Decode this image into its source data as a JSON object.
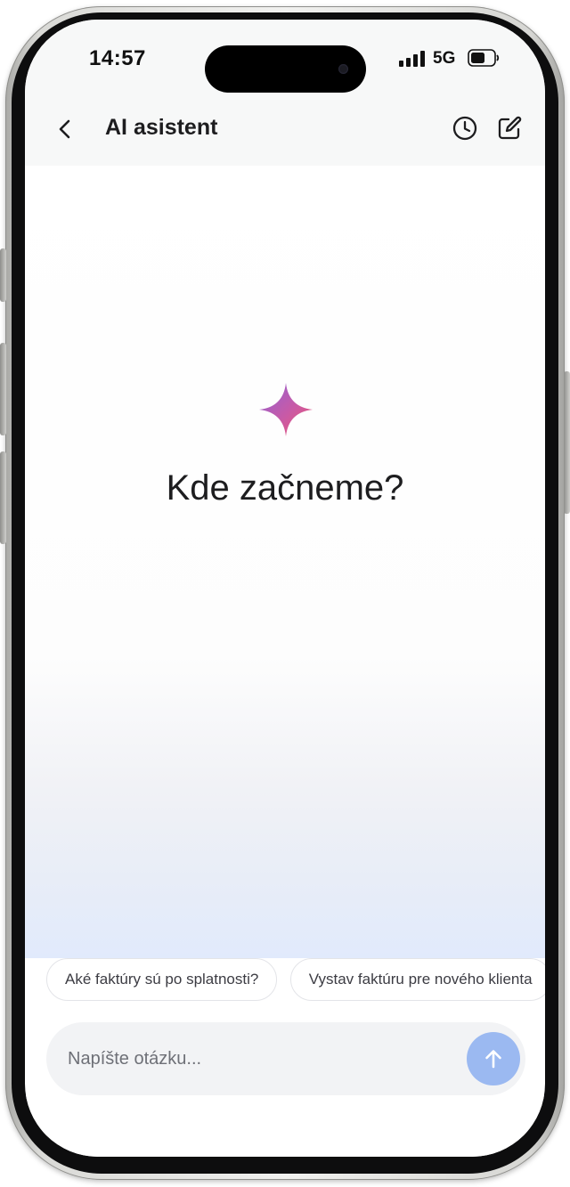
{
  "status_bar": {
    "time": "14:57",
    "network": "5G"
  },
  "header": {
    "title": "AI asistent",
    "back_icon": "chevron-left-icon",
    "history_icon": "clock-icon",
    "new_chat_icon": "compose-icon"
  },
  "main": {
    "heading": "Kde začneme?",
    "sparkle_icon": "sparkle-icon"
  },
  "suggestions": [
    {
      "label": "Aké faktúry sú po splatnosti?"
    },
    {
      "label": "Vystav faktúru pre nového klienta"
    }
  ],
  "composer": {
    "placeholder": "Napíšte otázku...",
    "value": "",
    "send_icon": "arrow-up-icon"
  },
  "colors": {
    "accent": "#9bb9f1",
    "sparkle_start": "#8f63d8",
    "sparkle_end": "#f0566f",
    "text": "#1d1d1f"
  }
}
